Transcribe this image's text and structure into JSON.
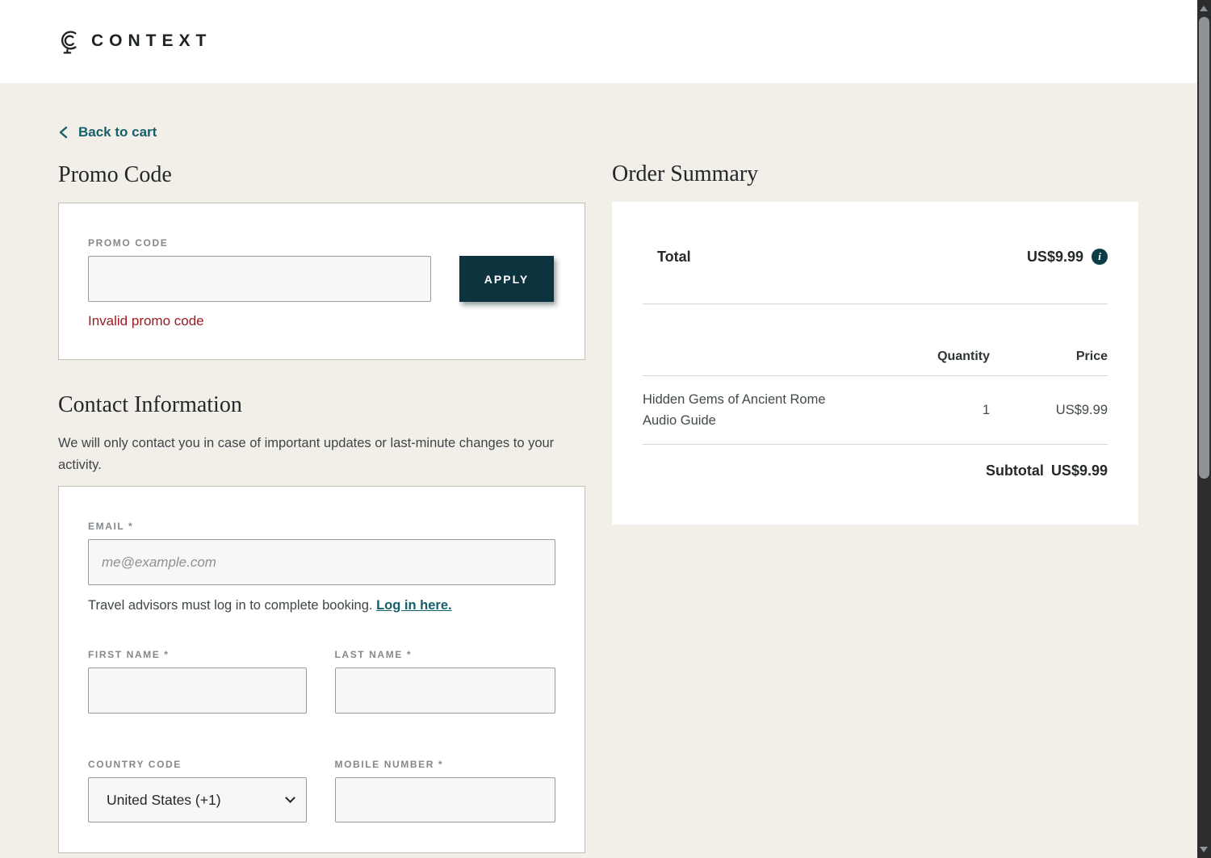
{
  "header": {
    "brand": "CONTEXT"
  },
  "nav": {
    "back_to_cart": "Back to cart"
  },
  "promo": {
    "title": "Promo Code",
    "label": "PROMO CODE",
    "input_value": "",
    "apply_label": "APPLY",
    "error": "Invalid promo code"
  },
  "contact": {
    "title": "Contact Information",
    "description": "We will only contact you in case of important updates or last-minute changes to your activity.",
    "email_label": "EMAIL *",
    "email_placeholder": "me@example.com",
    "advisor_note": "Travel advisors must log in to complete booking.",
    "login_link": "Log in here.",
    "first_name_label": "FIRST NAME *",
    "last_name_label": "LAST NAME *",
    "country_code_label": "COUNTRY CODE",
    "country_code_value": "United States (+1)",
    "mobile_label": "MOBILE NUMBER *"
  },
  "order": {
    "title": "Order Summary",
    "total_label": "Total",
    "total_value": "US$9.99",
    "quantity_header": "Quantity",
    "price_header": "Price",
    "items": [
      {
        "name": "Hidden Gems of Ancient Rome Audio Guide",
        "quantity": "1",
        "price": "US$9.99"
      }
    ],
    "subtotal_label": "Subtotal",
    "subtotal_value": "US$9.99"
  },
  "icons": {
    "logo": "globe-logo-icon",
    "back": "chevron-left-icon",
    "info": "info-icon",
    "select": "chevron-down-icon"
  },
  "colors": {
    "accent_teal": "#15606b",
    "button_teal": "#0c333e",
    "info_teal": "#0c3d47",
    "error_red": "#9e1b21",
    "page_bg": "#f2eee8",
    "header_bg": "#ffffff"
  }
}
